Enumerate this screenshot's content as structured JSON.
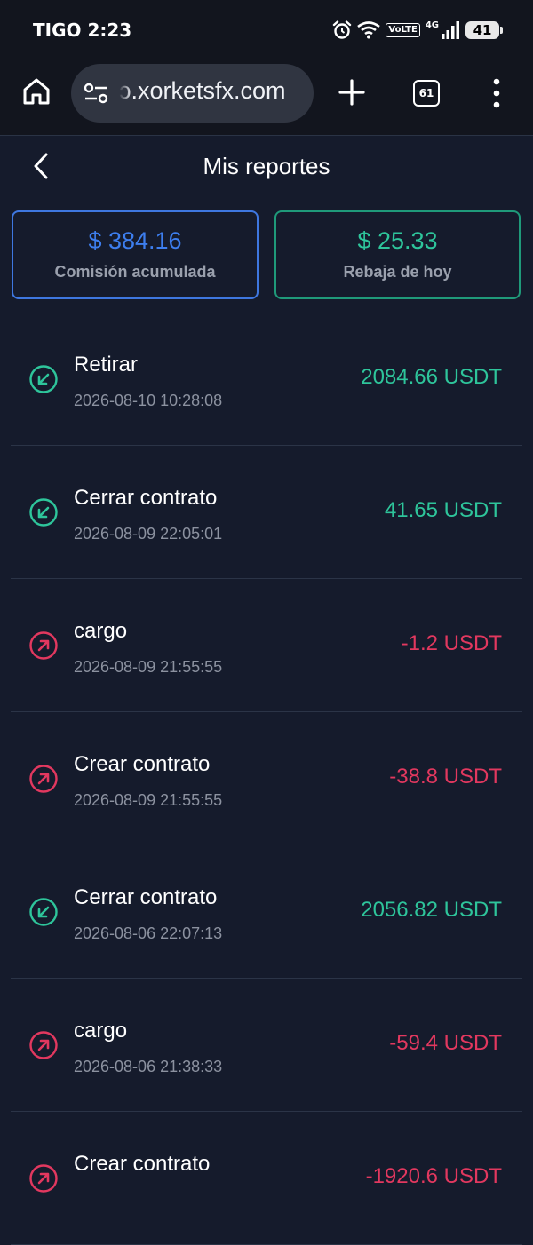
{
  "status_bar": {
    "carrier_time": "TIGO 2:23",
    "volte": "VoLTE",
    "network": "4G",
    "battery": "41"
  },
  "browser": {
    "url": "ɔ.xorketsfx.com",
    "tab_count": "61",
    "icons": [
      "home-icon",
      "site-settings-icon",
      "plus-icon",
      "tabs-icon",
      "menu-dots-icon"
    ]
  },
  "header": {
    "title": "Mis reportes"
  },
  "summary": {
    "commission": {
      "amount": "$ 384.16",
      "label": "Comisión acumulada",
      "color": "#3d7eee"
    },
    "rebate": {
      "amount": "$ 25.33",
      "label": "Rebaja de hoy",
      "color": "#2ec59b"
    }
  },
  "colors": {
    "background": "#151b2c",
    "positive": "#2ec59b",
    "negative": "#e2385f"
  },
  "transactions": [
    {
      "title": "Retirar",
      "time": "2026-08-10 10:28:08",
      "amount": "2084.66 USDT",
      "direction": "in"
    },
    {
      "title": "Cerrar contrato",
      "time": "2026-08-09 22:05:01",
      "amount": "41.65 USDT",
      "direction": "in"
    },
    {
      "title": "cargo",
      "time": "2026-08-09 21:55:55",
      "amount": "-1.2 USDT",
      "direction": "out"
    },
    {
      "title": "Crear contrato",
      "time": "2026-08-09 21:55:55",
      "amount": "-38.8 USDT",
      "direction": "out"
    },
    {
      "title": "Cerrar contrato",
      "time": "2026-08-06 22:07:13",
      "amount": "2056.82 USDT",
      "direction": "in"
    },
    {
      "title": "cargo",
      "time": "2026-08-06 21:38:33",
      "amount": "-59.4 USDT",
      "direction": "out"
    },
    {
      "title": "Crear contrato",
      "time": "",
      "amount": "-1920.6 USDT",
      "direction": "out"
    }
  ]
}
